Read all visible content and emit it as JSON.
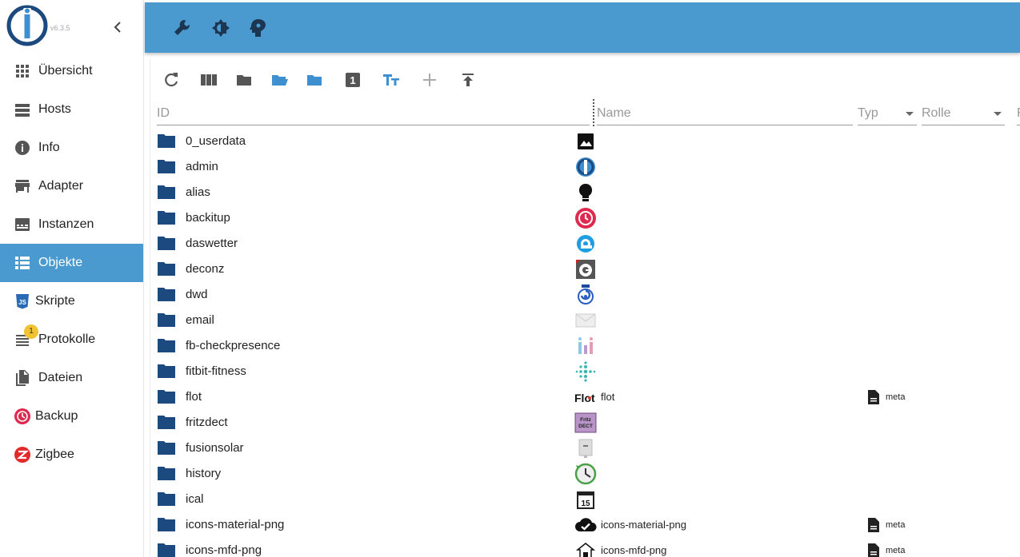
{
  "app": {
    "version": "v6.3.5",
    "accent": "#4a9ad0",
    "folder_color": "#1c4a7e"
  },
  "sidebar": {
    "items": [
      {
        "label": "Übersicht",
        "icon": "grid-icon"
      },
      {
        "label": "Hosts",
        "icon": "hosts-list-icon"
      },
      {
        "label": "Info",
        "icon": "info-icon"
      },
      {
        "label": "Adapter",
        "icon": "store-icon"
      },
      {
        "label": "Instanzen",
        "icon": "instances-icon"
      },
      {
        "label": "Objekte",
        "icon": "objects-list-icon",
        "active": true
      },
      {
        "label": "Skripte",
        "icon": "js-icon"
      },
      {
        "label": "Protokolle",
        "icon": "log-icon",
        "badge": "1"
      },
      {
        "label": "Dateien",
        "icon": "files-icon"
      },
      {
        "label": "Backup",
        "icon": "backup-icon"
      },
      {
        "label": "Zigbee",
        "icon": "zigbee-icon"
      }
    ]
  },
  "topbar": {
    "buttons": [
      "wrench-icon",
      "brightness-icon",
      "expert-mode-icon"
    ]
  },
  "toolbar": {
    "buttons": [
      "refresh-icon",
      "columns-icon",
      "folder-closed-icon",
      "folder-open-icon",
      "folder-icon",
      "number-1-icon",
      "text-size-icon",
      "add-icon",
      "upload-icon"
    ]
  },
  "filters": {
    "id_placeholder": "ID",
    "name_placeholder": "Name",
    "type_label": "Typ",
    "role_label": "Rolle",
    "next_label": "R"
  },
  "rows": [
    {
      "id": "0_userdata",
      "icon": "image-icon",
      "name": "",
      "type": ""
    },
    {
      "id": "admin",
      "icon": "iobroker-admin-icon",
      "name": "",
      "type": ""
    },
    {
      "id": "alias",
      "icon": "lightbulb-icon",
      "name": "",
      "type": ""
    },
    {
      "id": "backitup",
      "icon": "backitup-icon",
      "name": "",
      "type": ""
    },
    {
      "id": "daswetter",
      "icon": "daswetter-icon",
      "name": "",
      "type": ""
    },
    {
      "id": "deconz",
      "icon": "deconz-icon",
      "name": "",
      "type": ""
    },
    {
      "id": "dwd",
      "icon": "dwd-icon",
      "name": "",
      "type": ""
    },
    {
      "id": "email",
      "icon": "envelope-icon",
      "name": "",
      "type": ""
    },
    {
      "id": "fb-checkpresence",
      "icon": "fb-checkpresence-icon",
      "name": "",
      "type": ""
    },
    {
      "id": "fitbit-fitness",
      "icon": "fitbit-icon",
      "name": "",
      "type": ""
    },
    {
      "id": "flot",
      "icon": "flot-logo-icon",
      "icon_text": "Flot",
      "name": "flot",
      "type": "meta"
    },
    {
      "id": "fritzdect",
      "icon": "fritzdect-icon",
      "icon_text": "Fritz DECT",
      "name": "",
      "type": ""
    },
    {
      "id": "fusionsolar",
      "icon": "inverter-icon",
      "name": "",
      "type": ""
    },
    {
      "id": "history",
      "icon": "history-clock-icon",
      "name": "",
      "type": ""
    },
    {
      "id": "ical",
      "icon": "calendar-icon",
      "icon_text": "15",
      "name": "",
      "type": ""
    },
    {
      "id": "icons-material-png",
      "icon": "cloud-check-icon",
      "name": "icons-material-png",
      "type": "meta"
    },
    {
      "id": "icons-mfd-png",
      "icon": "house-icon",
      "name": "icons-mfd-png",
      "type": "meta"
    }
  ]
}
